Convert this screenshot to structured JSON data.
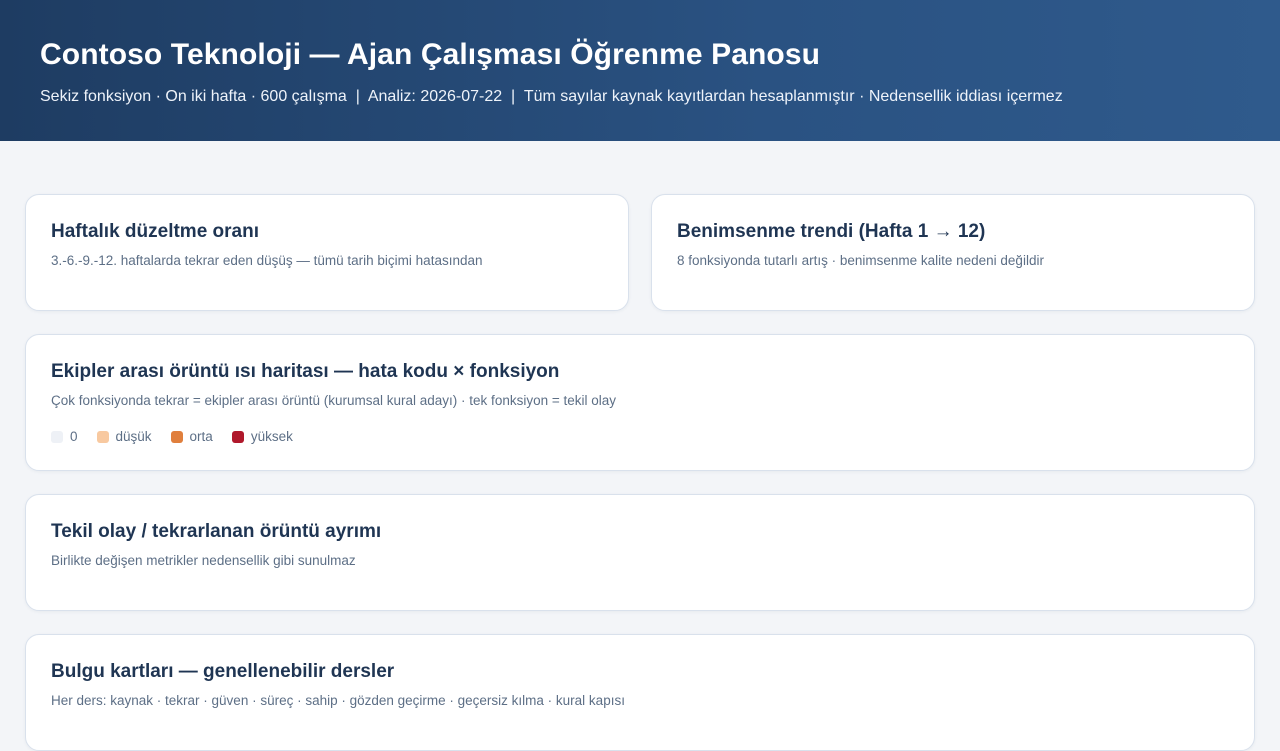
{
  "header": {
    "title": "Contoso Teknoloji — Ajan Çalışması Öğrenme Panosu",
    "subtitle": "Sekiz fonksiyon · On iki hafta · 600 çalışma  |  Analiz: 2026-07-22  |  Tüm sayılar kaynak kayıtlardan hesaplanmıştır · Nedensellik iddiası içermez"
  },
  "cards": {
    "correction": {
      "title": "Haftalık düzeltme oranı",
      "desc": "3.-6.-9.-12. haftalarda tekrar eden düşüş — tümü tarih biçimi hatasından"
    },
    "adoption": {
      "title": "Benimsenme trendi (Hafta 1 → 12)",
      "desc": "8 fonksiyonda tutarlı artış · benimsenme kalite nedeni değildir"
    },
    "heatmap": {
      "title": "Ekipler arası örüntü ısı haritası — hata kodu × fonksiyon",
      "desc": "Çok fonksiyonda tekrar = ekipler arası örüntü (kurumsal kural adayı) · tek fonksiyon = tekil olay",
      "legend": [
        {
          "label": "0",
          "color": "#eef1f6"
        },
        {
          "label": "düşük",
          "color": "#f8c9a0"
        },
        {
          "label": "orta",
          "color": "#e07f3d"
        },
        {
          "label": "yüksek",
          "color": "#b0182b"
        }
      ]
    },
    "incident": {
      "title": "Tekil olay / tekrarlanan örüntü ayrımı",
      "desc": "Birlikte değişen metrikler nedensellik gibi sunulmaz"
    },
    "findings": {
      "title": "Bulgu kartları — genellenebilir dersler",
      "desc": "Her ders: kaynak · tekrar · güven · süreç · sahip · gözden geçirme · geçersiz kılma · kural kapısı"
    }
  }
}
